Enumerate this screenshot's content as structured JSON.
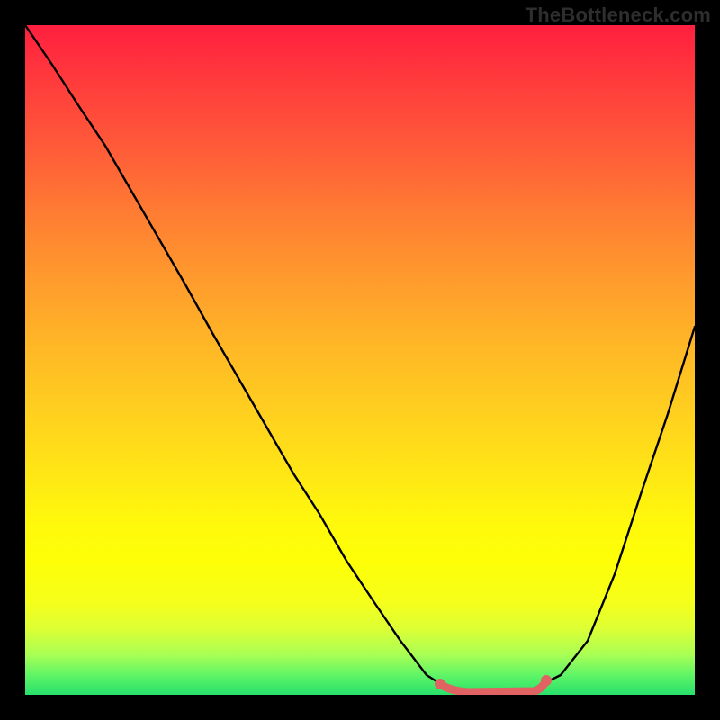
{
  "watermark": "TheBottleneck.com",
  "chart_data": {
    "type": "line",
    "title": "",
    "xlabel": "",
    "ylabel": "",
    "xlim": [
      0,
      100
    ],
    "ylim": [
      0,
      100
    ],
    "series": [
      {
        "name": "curve",
        "x": [
          0,
          4,
          8,
          12,
          16,
          20,
          24,
          28,
          32,
          36,
          40,
          44,
          48,
          52,
          56,
          60,
          64,
          68,
          72,
          76,
          80,
          84,
          88,
          92,
          96,
          100
        ],
        "values": [
          100,
          94,
          88,
          82,
          75,
          68,
          61,
          54,
          47,
          40,
          33,
          27,
          20,
          14,
          8,
          3,
          0,
          0,
          0,
          1,
          3,
          8,
          18,
          30,
          42,
          55
        ]
      }
    ],
    "annotations": [
      {
        "type": "marker-segment",
        "x_start": 62,
        "x_end": 78,
        "y": 1
      }
    ],
    "gradient_stops_percent_to_color": {
      "0": "#ff1f3f",
      "50": "#ffb726",
      "80": "#feff07",
      "100": "#27e06b"
    }
  }
}
